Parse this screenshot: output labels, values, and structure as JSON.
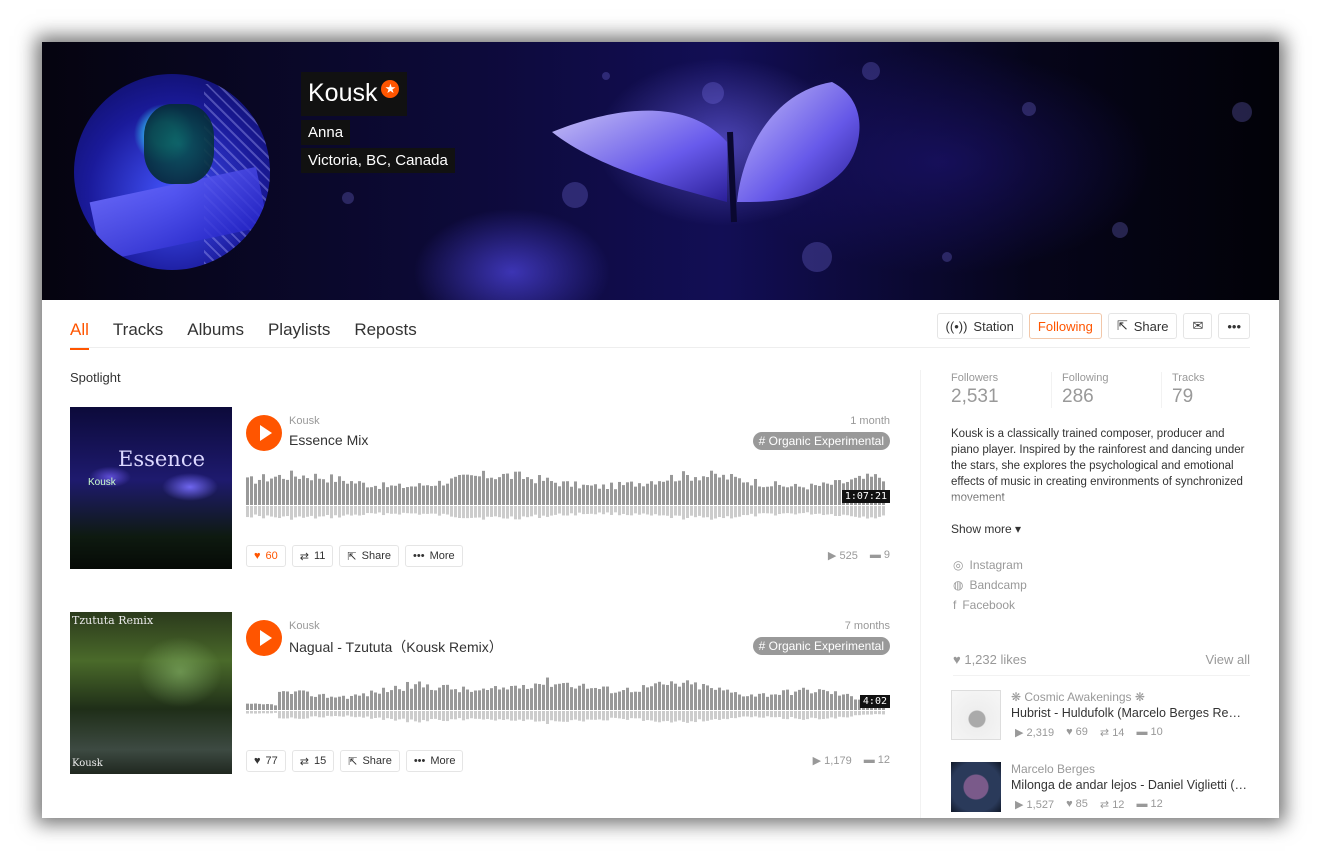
{
  "profile": {
    "name": "Kousk",
    "real_name": "Anna",
    "location": "Victoria, BC, Canada"
  },
  "tabs": [
    "All",
    "Tracks",
    "Albums",
    "Playlists",
    "Reposts"
  ],
  "actions": {
    "station": "Station",
    "following": "Following",
    "share": "Share"
  },
  "spotlight": {
    "label": "Spotlight",
    "tracks": [
      {
        "artist": "Kousk",
        "title": "Essence Mix",
        "date": "1 month",
        "tag": "# Organic Experimental",
        "duration": "1:07:21",
        "likes": "60",
        "reposts": "11",
        "share": "Share",
        "more": "More",
        "plays": "525",
        "comments": "9",
        "cover_text": "Essence",
        "cover_sub": "Kousk"
      },
      {
        "artist": "Kousk",
        "title": "Nagual - Tzututa（Kousk Remix）",
        "date": "7 months",
        "tag": "# Organic Experimental",
        "duration": "4:02",
        "likes": "77",
        "reposts": "15",
        "share": "Share",
        "more": "More",
        "plays": "1,179",
        "comments": "12",
        "cover_text": "Tzututa Remix",
        "cover_sub": "Kousk"
      }
    ]
  },
  "sidebar": {
    "followers_label": "Followers",
    "followers": "2,531",
    "following_label": "Following",
    "following": "286",
    "tracks_label": "Tracks",
    "tracks": "79",
    "bio": "Kousk is a classically trained composer, producer and piano player. Inspired by the rainforest and dancing under the stars, she explores the psychological and emotional effects of music in creating environments of synchronized movement",
    "show_more": "Show more",
    "links": [
      "Instagram",
      "Bandcamp",
      "Facebook"
    ],
    "likes_count": "1,232 likes",
    "view_all": "View all",
    "liked": [
      {
        "user": "❋ Cosmic Awakenings ❋",
        "title": "Hubrist - Huldufolk (Marcelo Berges Remix)",
        "plays": "2,319",
        "likes": "69",
        "reposts": "14",
        "comments": "10"
      },
      {
        "user": "Marcelo Berges",
        "title": "Milonga de andar lejos - Daniel Viglietti (Marcelo Berges Remix)",
        "plays": "1,527",
        "likes": "85",
        "reposts": "12",
        "comments": "12"
      }
    ]
  },
  "colors": {
    "accent": "#ff5500",
    "muted": "#999999",
    "text": "#333333"
  }
}
